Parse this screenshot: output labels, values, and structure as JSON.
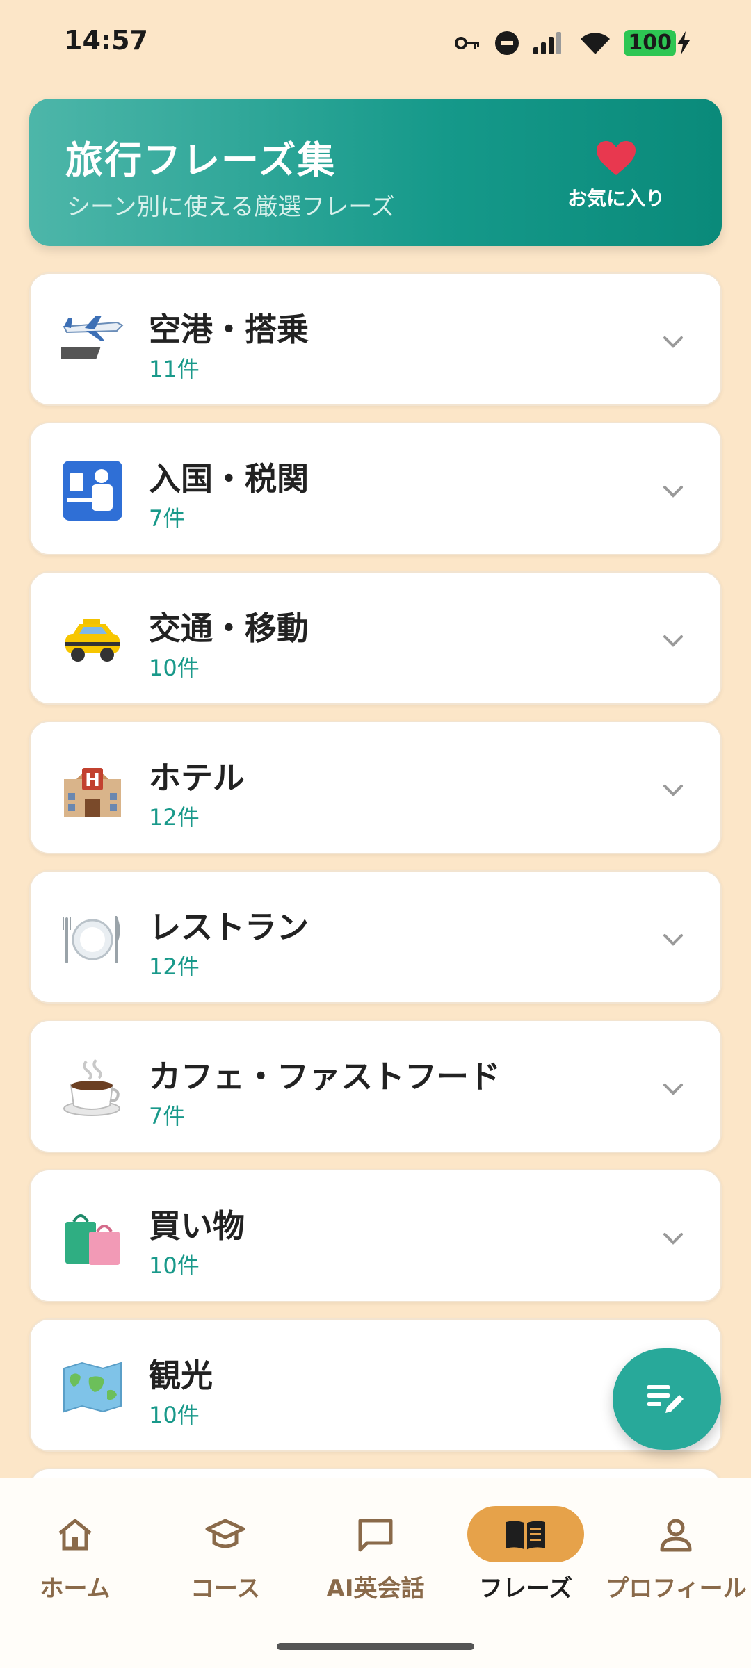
{
  "status_bar": {
    "time": "14:57",
    "battery": "100",
    "icons": [
      "key-icon",
      "do-not-disturb-icon",
      "signal-icon",
      "wifi-icon",
      "battery-icon",
      "charging-icon"
    ]
  },
  "header": {
    "title": "旅行フレーズ集",
    "subtitle": "シーン別に使える厳選フレーズ",
    "favorites_label": "お気に入り",
    "gradient_colors": [
      "#4db6a9",
      "#0a8a7a"
    ]
  },
  "categories": [
    {
      "name": "空港・搭乗",
      "count": "11件",
      "icon": "airplane-icon"
    },
    {
      "name": "入国・税関",
      "count": "7件",
      "icon": "passport-control-icon"
    },
    {
      "name": "交通・移動",
      "count": "10件",
      "icon": "taxi-icon"
    },
    {
      "name": "ホテル",
      "count": "12件",
      "icon": "hotel-icon"
    },
    {
      "name": "レストラン",
      "count": "12件",
      "icon": "plate-cutlery-icon"
    },
    {
      "name": "カフェ・ファストフード",
      "count": "7件",
      "icon": "coffee-icon"
    },
    {
      "name": "買い物",
      "count": "10件",
      "icon": "shopping-bags-icon"
    },
    {
      "name": "観光",
      "count": "10件",
      "icon": "world-map-icon"
    }
  ],
  "bottom_nav": {
    "items": [
      {
        "label": "ホーム",
        "icon": "home-icon",
        "active": false
      },
      {
        "label": "コース",
        "icon": "graduation-cap-icon",
        "active": false
      },
      {
        "label": "AI英会話",
        "icon": "chat-bubble-icon",
        "active": false
      },
      {
        "label": "フレーズ",
        "icon": "book-icon",
        "active": true
      },
      {
        "label": "プロフィール",
        "icon": "person-icon",
        "active": false
      }
    ],
    "active_color": "#e6a24a"
  },
  "fab": {
    "icon": "edit-list-icon",
    "color": "#28a99a"
  },
  "colors": {
    "background": "#fce6c8",
    "accent": "#19998a",
    "favorite": "#e8384f"
  }
}
